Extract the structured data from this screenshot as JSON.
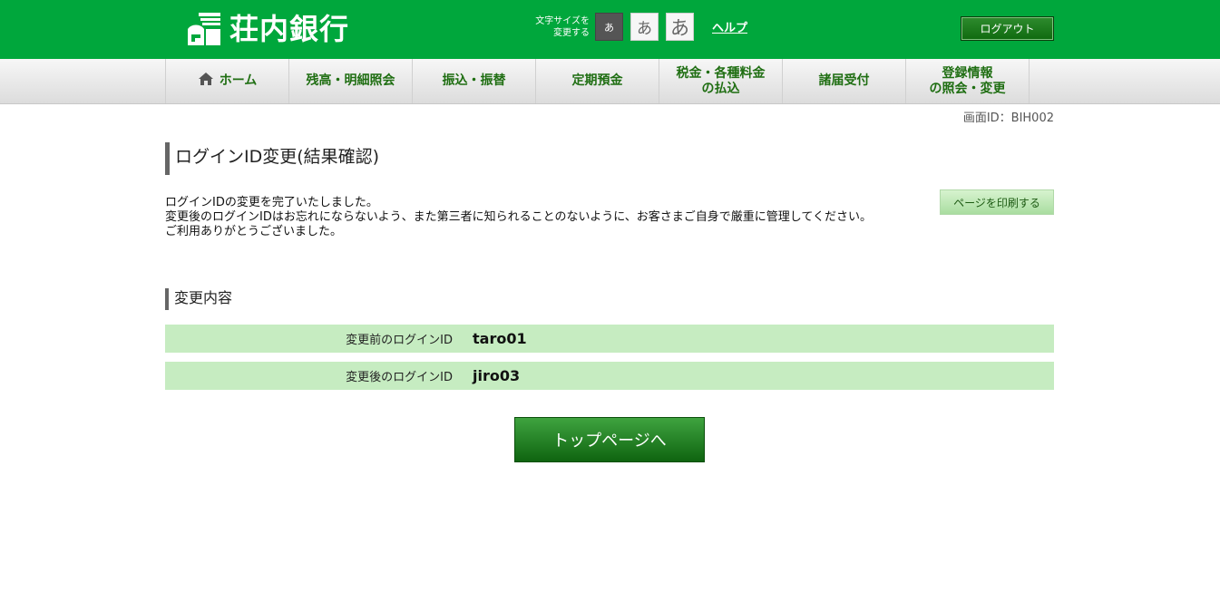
{
  "header": {
    "bank_name": "荘内銀行",
    "font_size_label_line1": "文字サイズを",
    "font_size_label_line2": "変更する",
    "font_sizes": [
      "あ",
      "あ",
      "あ"
    ],
    "help_label": "ヘルプ",
    "logout_label": "ログアウト",
    "brand_color": "#00a73c"
  },
  "nav": {
    "home": "ホーム",
    "balance": "残高・明細照会",
    "transfer": "振込・振替",
    "time_deposit": "定期預金",
    "tax_line1": "税金・各種料金",
    "tax_line2": "の払込",
    "applications": "諸届受付",
    "registration_line1": "登録情報",
    "registration_line2": "の照会・変更"
  },
  "screen_id": "画面ID：BIH002",
  "page_title": "ログインID変更(結果確認)",
  "message": {
    "line1": "ログインIDの変更を完了いたしました。",
    "line2": "変更後のログインIDはお忘れにならないよう、また第三者に知られることのないように、お客さまご自身で厳重に管理してください。",
    "line3": "ご利用ありがとうございました。"
  },
  "print_label": "ページを印刷する",
  "section_title": "変更内容",
  "details": [
    {
      "label": "変更前のログインID",
      "value": "taro01"
    },
    {
      "label": "変更後のログインID",
      "value": "jiro03"
    }
  ],
  "top_button_label": "トップページへ"
}
